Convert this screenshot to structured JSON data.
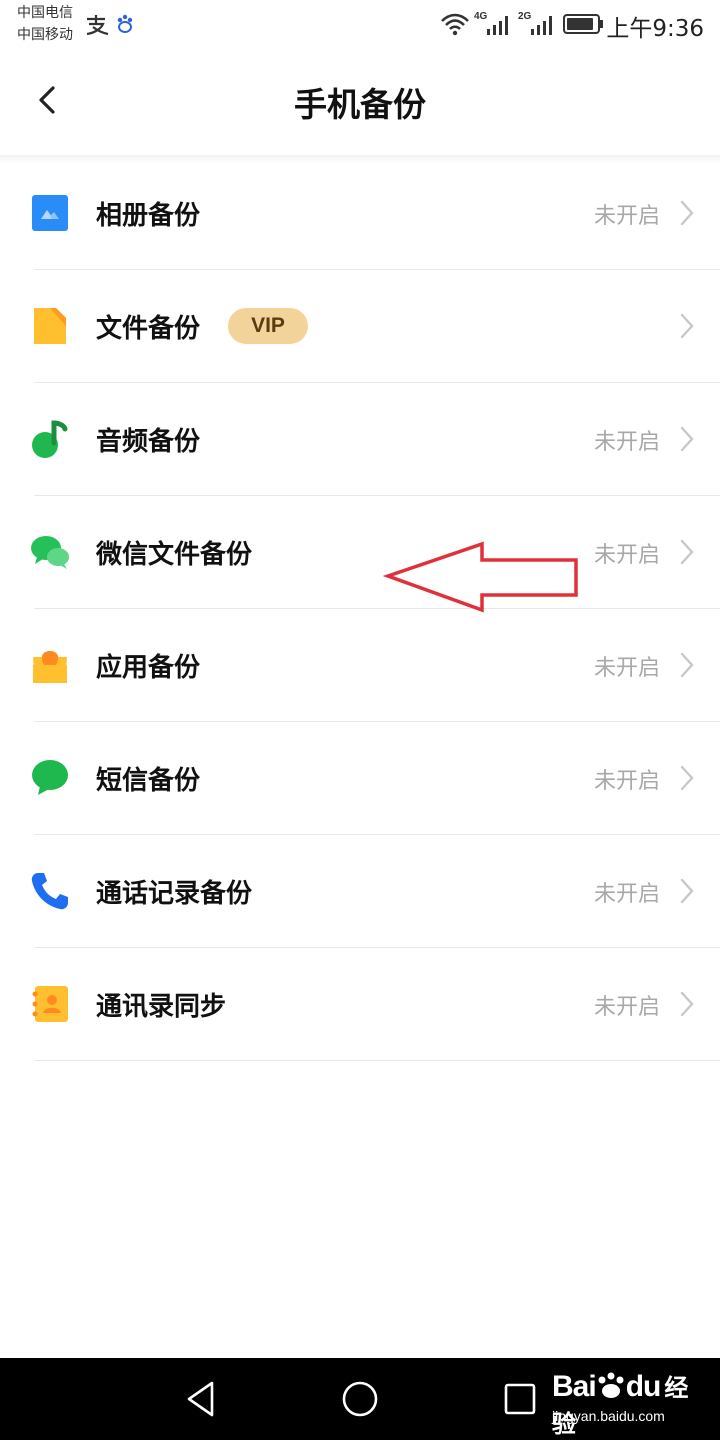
{
  "status_bar": {
    "carrier1": "中国电信",
    "carrier2": "中国移动",
    "net_4g": "4G",
    "net_2g": "2G",
    "time": "上午9:36",
    "icons": [
      "alipay-icon",
      "baidu-paw-icon",
      "wifi-icon",
      "signal-4g-icon",
      "signal-2g-icon",
      "battery-icon"
    ]
  },
  "header": {
    "title": "手机备份",
    "back_icon": "chevron-left-icon"
  },
  "backup_items": [
    {
      "label": "相册备份",
      "status": "未开启",
      "icon": "photo-album-icon",
      "color": "#2a8cf7"
    },
    {
      "label": "文件备份",
      "badge": "VIP",
      "status": "",
      "icon": "file-icon",
      "color": "#ffbf2e"
    },
    {
      "label": "音频备份",
      "status": "未开启",
      "icon": "music-note-icon",
      "color": "#1fb84f"
    },
    {
      "label": "微信文件备份",
      "status": "未开启",
      "icon": "wechat-icon",
      "color": "#26c05a"
    },
    {
      "label": "应用备份",
      "status": "未开启",
      "icon": "app-bag-icon",
      "color": "#ffbf2e"
    },
    {
      "label": "短信备份",
      "status": "未开启",
      "icon": "message-bubble-icon",
      "color": "#1fb84f"
    },
    {
      "label": "通话记录备份",
      "status": "未开启",
      "icon": "phone-icon",
      "color": "#1f6ef2"
    },
    {
      "label": "通讯录同步",
      "status": "未开启",
      "icon": "contacts-book-icon",
      "color": "#ffbf2e"
    }
  ],
  "annotation": {
    "type": "red-arrow-left",
    "color": "#e0313a"
  },
  "nav_bar": {
    "buttons": [
      "back-triangle-icon",
      "home-circle-icon",
      "recents-square-icon"
    ]
  },
  "watermark": {
    "brand": "Bai",
    "brand2": "du",
    "brand3": "经验",
    "url": "jingyan.baidu.com"
  }
}
